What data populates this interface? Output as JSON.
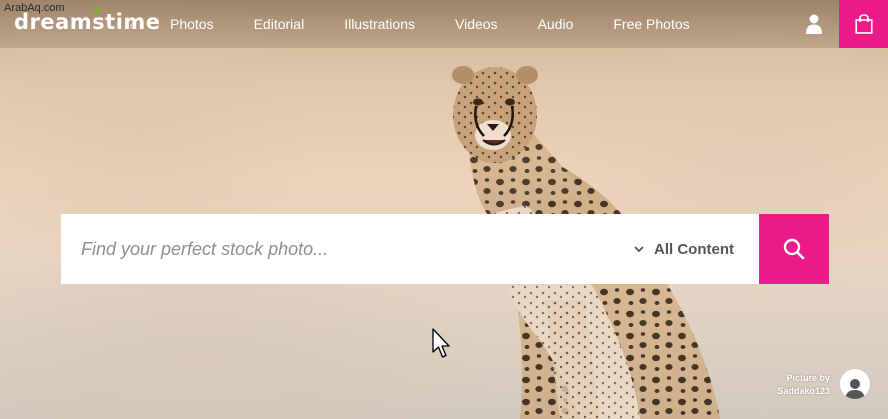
{
  "watermark": "ArabAq.com",
  "brand": {
    "logo_text": "dreamstime",
    "registered_mark": "®"
  },
  "nav": {
    "items": [
      {
        "label": "Photos"
      },
      {
        "label": "Editorial"
      },
      {
        "label": "Illustrations"
      },
      {
        "label": "Videos"
      },
      {
        "label": "Audio"
      },
      {
        "label": "Free Photos"
      }
    ],
    "user_icon": "user-icon",
    "cart_icon": "shopping-bag-icon"
  },
  "search": {
    "placeholder": "Find your perfect stock photo...",
    "content_filter": "All Content",
    "chevron_icon": "chevron-down-icon",
    "button_icon": "search-icon"
  },
  "credit": {
    "line1": "Picture by",
    "author": "Saddako123",
    "avatar_icon": "user-avatar-icon"
  },
  "colors": {
    "accent": "#ed1b8a",
    "logo_leaf": "#7fb23a",
    "nav_text": "#ffffff",
    "search_placeholder": "#8f8f8f",
    "filter_text": "#555555"
  }
}
